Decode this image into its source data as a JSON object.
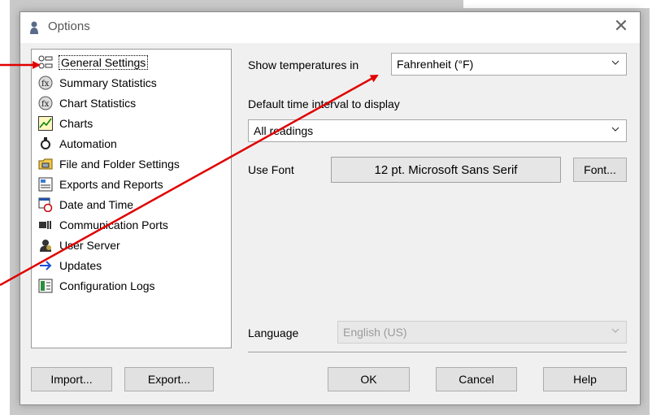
{
  "window": {
    "title": "Options",
    "close_icon": "close-icon"
  },
  "tree": {
    "items": [
      {
        "label": "General Settings",
        "icon": "general-settings-icon"
      },
      {
        "label": "Summary Statistics",
        "icon": "summary-statistics-icon"
      },
      {
        "label": "Chart Statistics",
        "icon": "chart-statistics-icon"
      },
      {
        "label": "Charts",
        "icon": "charts-icon"
      },
      {
        "label": "Automation",
        "icon": "automation-icon"
      },
      {
        "label": "File and Folder Settings",
        "icon": "folder-icon"
      },
      {
        "label": "Exports and Reports",
        "icon": "exports-icon"
      },
      {
        "label": "Date and Time",
        "icon": "date-time-icon"
      },
      {
        "label": "Communication Ports",
        "icon": "communication-ports-icon"
      },
      {
        "label": "User Server",
        "icon": "user-server-icon"
      },
      {
        "label": "Updates",
        "icon": "updates-arrow-icon"
      },
      {
        "label": "Configuration Logs",
        "icon": "configuration-logs-icon"
      }
    ]
  },
  "settings": {
    "temperature_label": "Show temperatures in",
    "temperature_value": "Fahrenheit (°F)",
    "interval_label": "Default time interval to display",
    "interval_value": "All readings",
    "font_label": "Use Font",
    "font_value": "12 pt. Microsoft Sans Serif",
    "font_button": "Font...",
    "language_label": "Language",
    "language_value": "English (US)"
  },
  "buttons": {
    "import": "Import...",
    "export": "Export...",
    "ok": "OK",
    "cancel": "Cancel",
    "help": "Help"
  },
  "annotation_color": "#e00000"
}
